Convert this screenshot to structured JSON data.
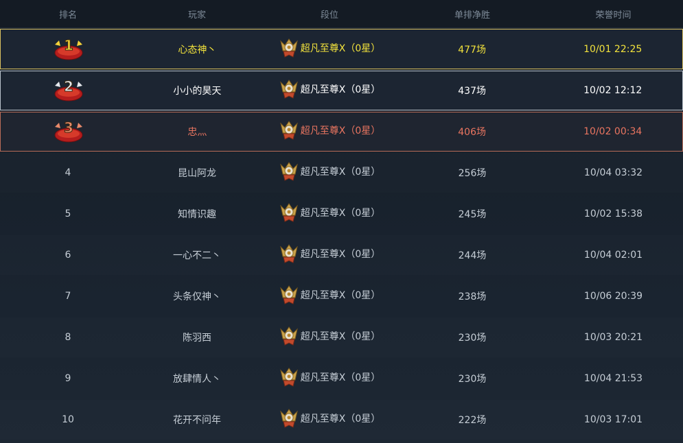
{
  "header": {
    "rank": "排名",
    "player": "玩家",
    "tier": "段位",
    "wins": "单排净胜",
    "time": "荣誉时间"
  },
  "colors": {
    "gold": "#f3e33c",
    "silver": "#ffffff",
    "bronze": "#ea7560"
  },
  "rows": [
    {
      "rank": "1",
      "medal": "gold-medal-icon",
      "player": "心态神丶",
      "tier": "超凡至尊Ⅹ（0星）",
      "wins": "477场",
      "time": "10/01 22:25"
    },
    {
      "rank": "2",
      "medal": "silver-medal-icon",
      "player": "小小的昊天",
      "tier": "超凡至尊Ⅹ（0星）",
      "wins": "437场",
      "time": "10/02 12:12"
    },
    {
      "rank": "3",
      "medal": "bronze-medal-icon",
      "player": "忠灬",
      "tier": "超凡至尊Ⅹ（0星）",
      "wins": "406场",
      "time": "10/02 00:34"
    },
    {
      "rank": "4",
      "player": "昆山阿龙",
      "tier": "超凡至尊Ⅹ（0星）",
      "wins": "256场",
      "time": "10/04 03:32"
    },
    {
      "rank": "5",
      "player": "知情识趣",
      "tier": "超凡至尊Ⅹ（0星）",
      "wins": "245场",
      "time": "10/02 15:38"
    },
    {
      "rank": "6",
      "player": "一心不二丶",
      "tier": "超凡至尊Ⅹ（0星）",
      "wins": "244场",
      "time": "10/04 02:01"
    },
    {
      "rank": "7",
      "player": "头条仅神丶",
      "tier": "超凡至尊Ⅹ（0星）",
      "wins": "238场",
      "time": "10/06 20:39"
    },
    {
      "rank": "8",
      "player": "陈羽西",
      "tier": "超凡至尊Ⅹ（0星）",
      "wins": "230场",
      "time": "10/03 20:21"
    },
    {
      "rank": "9",
      "player": "放肆情人丶",
      "tier": "超凡至尊Ⅹ（0星）",
      "wins": "230场",
      "time": "10/04 21:53"
    },
    {
      "rank": "10",
      "player": "花开不问年",
      "tier": "超凡至尊Ⅹ（0星）",
      "wins": "222场",
      "time": "10/03 17:01"
    }
  ]
}
